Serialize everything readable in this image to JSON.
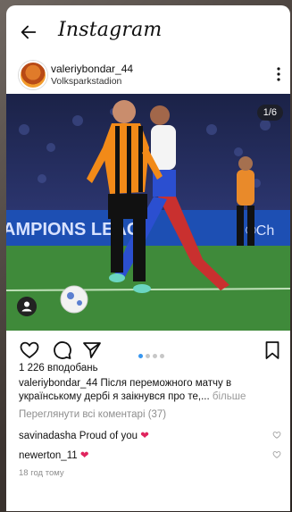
{
  "app": {
    "title": "Instagram"
  },
  "post": {
    "username": "valeriybondar_44",
    "location": "Volksparkstadion",
    "counter": "1/6",
    "likes": "1 226 вподобань",
    "caption_user": "valeriybondar_44",
    "caption_text": "Після переможного матчу в українському дербі я заікнувся про те,...",
    "caption_more": "більше",
    "view_all_comments": "Переглянути всі коментарі (37)",
    "comments": [
      {
        "user": "savinadasha",
        "text": "Proud of you",
        "emoji": "❤"
      },
      {
        "user": "newerton_11",
        "text": "",
        "emoji": "❤"
      }
    ],
    "time": "18 год тому"
  },
  "carousel": {
    "total": 6,
    "active": 1
  },
  "colors": {
    "accent": "#3897f0",
    "heart": "#e0245e"
  },
  "icons": [
    "back-arrow-icon",
    "more-options-icon",
    "heart-icon",
    "comment-icon",
    "send-icon",
    "bookmark-icon",
    "user-tag-icon"
  ]
}
